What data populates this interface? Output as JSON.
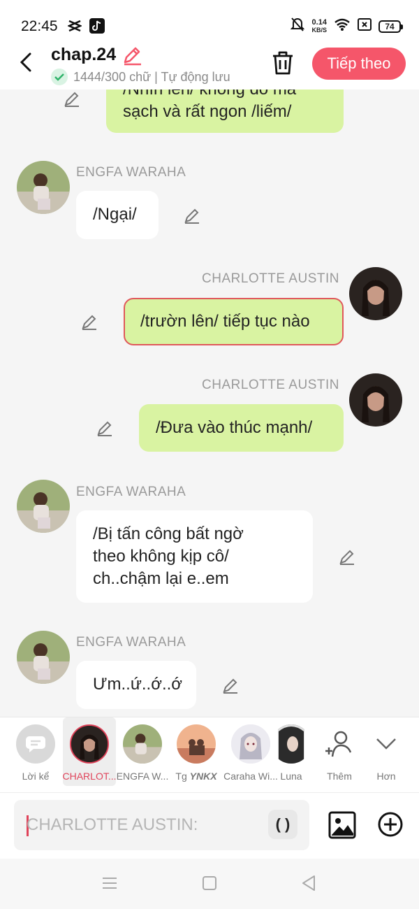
{
  "status_bar": {
    "time": "22:45",
    "net_speed_value": "0.14",
    "net_speed_unit": "KB/S",
    "battery": "74",
    "icons": [
      "capcut-icon",
      "tiktok-icon",
      "bell-off-icon",
      "wifi-icon",
      "close-box-icon",
      "battery-icon"
    ]
  },
  "header": {
    "title": "chap.24",
    "subtitle": "1444/300 chữ | Tự động lưu",
    "next_label": "Tiếp theo",
    "accent": "#f5566a"
  },
  "messages": [
    {
      "side": "right",
      "text": "/Nhìn lên/ không do mà sạch và rất ngon /liếm/",
      "line1": "/Nhìn lên/ không do mà",
      "line2": "sạch và rất ngon /liếm/"
    },
    {
      "side": "left",
      "speaker": "ENGFA WARAHA",
      "text": "/Ngại/"
    },
    {
      "side": "right",
      "speaker": "CHARLOTTE AUSTIN",
      "text": "/trườn lên/ tiếp tục nào"
    },
    {
      "side": "right",
      "speaker": "CHARLOTTE AUSTIN",
      "text": "/Đưa vào thúc mạnh/"
    },
    {
      "side": "left",
      "speaker": "ENGFA WARAHA",
      "line1": "/Bị tấn công bất ngờ",
      "line2": "theo không kịp cô/",
      "line3": "ch..chậm lại e..em"
    },
    {
      "side": "left",
      "speaker": "ENGFA WARAHA",
      "text": "Ưm..ứ..ớ..ớ"
    }
  ],
  "characters": [
    {
      "label": "Lời kể"
    },
    {
      "label": "CHARLOT..."
    },
    {
      "label": "ENGFA W..."
    },
    {
      "label": "Tg YNKX",
      "prefix": "Tg ",
      "bold": "YNKX"
    },
    {
      "label": "Caraha Wi..."
    },
    {
      "label": "Luna"
    },
    {
      "label": "Thêm"
    },
    {
      "label": "Hơn"
    }
  ],
  "input": {
    "placeholder": "CHARLOTTE AUSTIN:",
    "paren_label": "( )"
  },
  "colors": {
    "green_bubble": "#d9f3a2",
    "highlight_border": "#e0575b",
    "selected": "#e0435a"
  }
}
